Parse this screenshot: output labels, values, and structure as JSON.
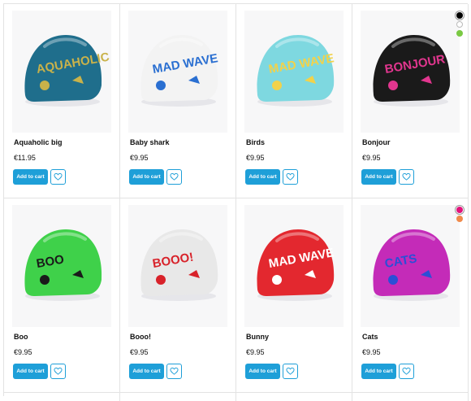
{
  "products": [
    {
      "name": "Aquaholic big",
      "price": "€11.95",
      "cap_color": "#1f6e8c",
      "print_color": "#c9b24a",
      "print_text": "AQUAHOLIC",
      "swatches": []
    },
    {
      "name": "Baby shark",
      "price": "€9.95",
      "cap_color": "#f3f3f3",
      "print_color": "#2a6fd1",
      "print_text": "MAD WAVE",
      "swatches": []
    },
    {
      "name": "Birds",
      "price": "€9.95",
      "cap_color": "#7ed8e0",
      "print_color": "#f2d24a",
      "print_text": "MAD WAVE",
      "swatches": []
    },
    {
      "name": "Bonjour",
      "price": "€9.95",
      "cap_color": "#1a1a1a",
      "print_color": "#e2368f",
      "print_text": "BONJOUR",
      "swatches": [
        "#000000",
        "#ffffff",
        "#7ac943"
      ]
    },
    {
      "name": "Boo",
      "price": "€9.95",
      "cap_color": "#3fd14a",
      "print_color": "#1a1a1a",
      "print_text": "BOO",
      "swatches": []
    },
    {
      "name": "Booo!",
      "price": "€9.95",
      "cap_color": "#e8e8e8",
      "print_color": "#d8222a",
      "print_text": "BOOO!",
      "swatches": []
    },
    {
      "name": "Bunny",
      "price": "€9.95",
      "cap_color": "#e3282f",
      "print_color": "#ffffff",
      "print_text": "MAD WAVE",
      "swatches": []
    },
    {
      "name": "Cats",
      "price": "€9.95",
      "cap_color": "#c42bb8",
      "print_color": "#2a4fd6",
      "print_text": "CATS",
      "swatches": [
        "#e2127b",
        "#f08a4b"
      ]
    }
  ],
  "add_to_cart_label": "Add to cart",
  "accent_color": "#1e9fd8",
  "icons": {
    "wishlist": "heart-icon"
  }
}
